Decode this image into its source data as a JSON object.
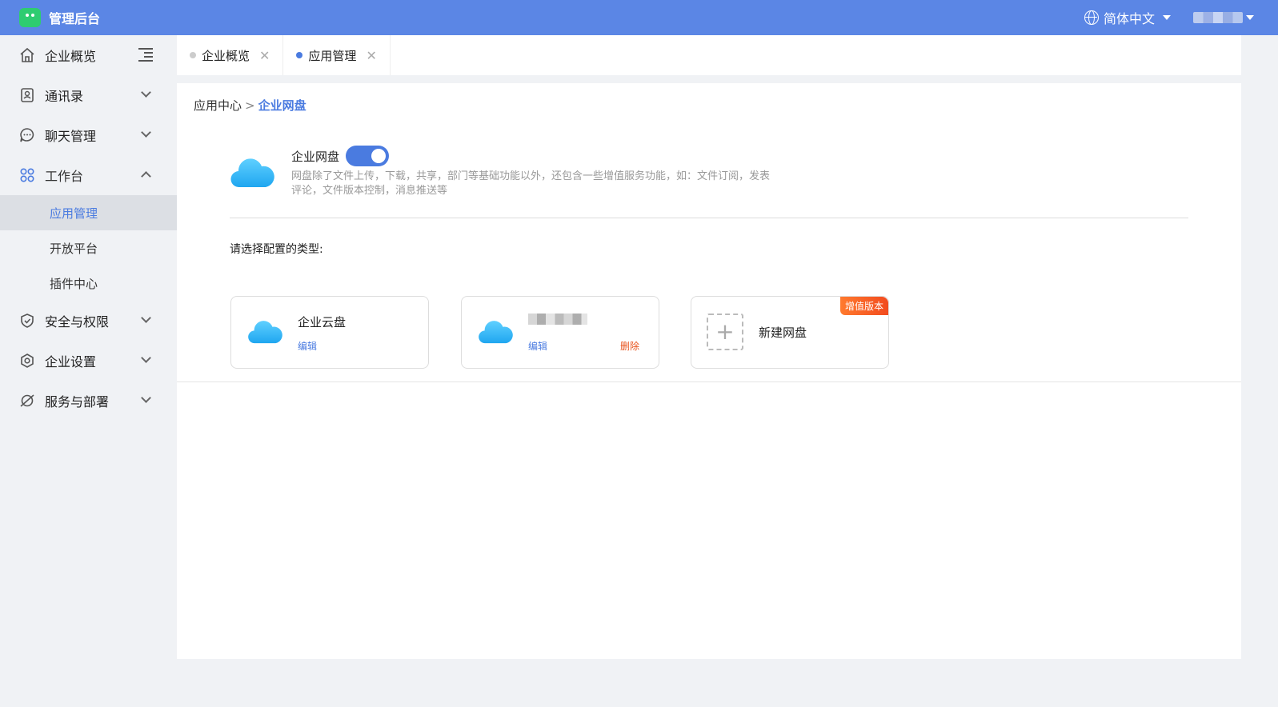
{
  "header": {
    "title": "管理后台",
    "language": "简体中文"
  },
  "sidebar": {
    "items": [
      {
        "label": "企业概览"
      },
      {
        "label": "通讯录"
      },
      {
        "label": "聊天管理"
      },
      {
        "label": "工作台"
      },
      {
        "label": "安全与权限"
      },
      {
        "label": "企业设置"
      },
      {
        "label": "服务与部署"
      }
    ],
    "workbench_sub": [
      {
        "label": "应用管理"
      },
      {
        "label": "开放平台"
      },
      {
        "label": "插件中心"
      }
    ]
  },
  "tabs": [
    {
      "label": "企业概览"
    },
    {
      "label": "应用管理"
    }
  ],
  "breadcrumb": {
    "parent": "应用中心",
    "separator": ">",
    "current": "企业网盘"
  },
  "app": {
    "title": "企业网盘",
    "enabled": true,
    "description": "网盘除了文件上传，下载，共享，部门等基础功能以外，还包含一些增值服务功能，如：文件订阅，发表评论，文件版本控制，消息推送等"
  },
  "select_label": "请选择配置的类型:",
  "cards": {
    "card1": {
      "title": "企业云盘",
      "edit": "编辑"
    },
    "card2": {
      "edit": "编辑",
      "delete": "删除"
    },
    "card3": {
      "title": "新建网盘",
      "badge": "增值版本"
    }
  },
  "colors": {
    "header": "#5b86e5",
    "accent": "#4a7be0",
    "danger": "#e8541e",
    "badge": "#f24b1f"
  }
}
